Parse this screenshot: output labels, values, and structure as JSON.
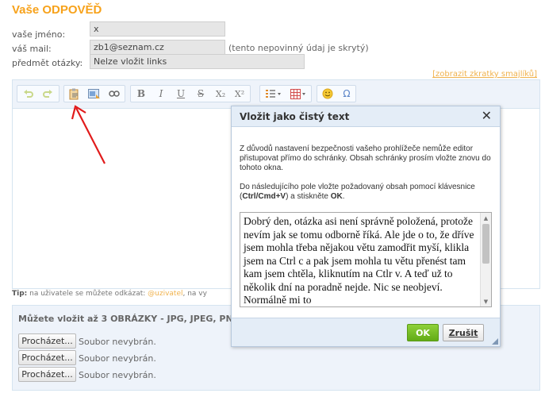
{
  "page": {
    "title": "Vaše ODPOVĚĎ"
  },
  "form": {
    "name_label": "vaše jméno:",
    "name_value": "x",
    "mail_label": "váš mail:",
    "mail_value": "zb1@seznam.cz",
    "mail_note": "(tento nepovinný údaj je skrytý)",
    "subject_label": "předmět otázky:",
    "subject_value": "Nelze vložit links"
  },
  "editor": {
    "smiley_link": "[zobrazit zkratky smajlíků]",
    "toolbar_icons": [
      "undo-icon",
      "redo-icon",
      "paste-text-icon",
      "paste-word-icon",
      "find-icon",
      "bold-icon",
      "italic-icon",
      "underline-icon",
      "strike-icon",
      "subscript-icon",
      "superscript-icon",
      "list-icon",
      "table-icon",
      "smiley-icon",
      "special-char-icon"
    ],
    "bold": "B",
    "italic": "I",
    "underline": "U",
    "strike": "S",
    "subscript": "X₂",
    "superscript": "X²",
    "omega": "Ω"
  },
  "tip": {
    "prefix": "Tip:",
    "text": " na uživatele se můžete odkázat: ",
    "mention": "@uzivatel",
    "suffix": ", na vy"
  },
  "upload": {
    "title": "Můžete vložit až 3 OBRÁZKY - JPG, JPEG, PNG,",
    "buttons": [
      {
        "label": "Procházet...",
        "status": "Soubor nevybrán."
      },
      {
        "label": "Procházet...",
        "status": "Soubor nevybrán."
      },
      {
        "label": "Procházet...",
        "status": "Soubor nevybrán."
      }
    ]
  },
  "dialog": {
    "title": "Vložit jako čistý text",
    "close": "✕",
    "para1": "Z důvodů nastavení bezpečnosti vašeho prohlížeče nemůže editor přistupovat přímo do schránky. Obsah schránky prosím vložte znovu do tohoto okna.",
    "para2_prefix": "Do následujícího pole vložte požadovaný obsah pomocí klávesnice (",
    "para2_keys": "Ctrl/Cmd+V",
    "para2_mid": ") a stiskněte ",
    "para2_ok": "OK",
    "para2_end": ".",
    "paste_content": "Dobrý den, otázka asi není správně položená, protože nevím jak se tomu odborně říká. Ale jde o to, že dříve jsem mohla třeba nějakou větu zamodřit myší, klikla jsem na Ctrl c a pak jsem mohla tu větu přenést tam kam jsem chtěla, kliknutím na Ctlr v. A teď už to několik dní na poradně nejde. Nic se neobjeví. Normálně mi to",
    "ok_label": "OK",
    "cancel_label": "Zrušit"
  },
  "colors": {
    "accent": "#f7a21b",
    "ok_green": "#6cb71d",
    "annotation_red": "#e11b1b"
  }
}
